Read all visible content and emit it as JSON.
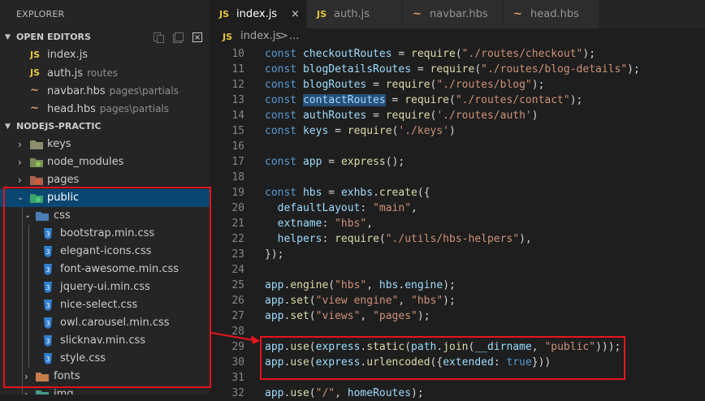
{
  "explorer": {
    "title": "EXPLORER",
    "open_editors": {
      "label": "OPEN EDITORS",
      "items": [
        {
          "icon": "JS",
          "name": "index.js",
          "path": ""
        },
        {
          "icon": "JS",
          "name": "auth.js",
          "path": "routes"
        },
        {
          "icon": "~",
          "name": "navbar.hbs",
          "path": "pages\\partials"
        },
        {
          "icon": "~",
          "name": "head.hbs",
          "path": "pages\\partials"
        }
      ]
    },
    "project": {
      "label": "NODEJS-PRACTIC",
      "items": [
        {
          "name": "keys"
        },
        {
          "name": "node_modules"
        },
        {
          "name": "pages"
        },
        {
          "name": "public"
        },
        {
          "name": "css"
        },
        {
          "name": "bootstrap.min.css"
        },
        {
          "name": "elegant-icons.css"
        },
        {
          "name": "font-awesome.min.css"
        },
        {
          "name": "jquery-ui.min.css"
        },
        {
          "name": "nice-select.css"
        },
        {
          "name": "owl.carousel.min.css"
        },
        {
          "name": "slicknav.min.css"
        },
        {
          "name": "style.css"
        },
        {
          "name": "fonts"
        },
        {
          "name": "img"
        }
      ]
    }
  },
  "tabs": [
    {
      "icon": "JS",
      "label": "index.js",
      "close": "×"
    },
    {
      "icon": "JS",
      "label": "auth.js"
    },
    {
      "icon": "~",
      "label": "navbar.hbs"
    },
    {
      "icon": "~",
      "label": "head.hbs"
    }
  ],
  "breadcrumb": {
    "icon": "JS",
    "file": "index.js",
    "sep": ">",
    "more": "..."
  },
  "code_lines": [
    {
      "n": "10",
      "t": [
        [
          "k",
          "const "
        ],
        [
          "v",
          "checkoutRoutes"
        ],
        [
          "p",
          " = "
        ],
        [
          "f",
          "require"
        ],
        [
          "p",
          "("
        ],
        [
          "s",
          "\"./routes/checkout\""
        ],
        [
          "p",
          ");"
        ]
      ]
    },
    {
      "n": "11",
      "t": [
        [
          "k",
          "const "
        ],
        [
          "v",
          "blogDetailsRoutes"
        ],
        [
          "p",
          " = "
        ],
        [
          "f",
          "require"
        ],
        [
          "p",
          "("
        ],
        [
          "s",
          "\"./routes/blog-details\""
        ],
        [
          "p",
          ");"
        ]
      ]
    },
    {
      "n": "12",
      "t": [
        [
          "k",
          "const "
        ],
        [
          "v",
          "blogRoutes"
        ],
        [
          "p",
          " = "
        ],
        [
          "f",
          "require"
        ],
        [
          "p",
          "("
        ],
        [
          "s",
          "\"./routes/blog\""
        ],
        [
          "p",
          ");"
        ]
      ]
    },
    {
      "n": "13",
      "t": [
        [
          "k",
          "const "
        ],
        [
          "hl",
          "contactRoutes"
        ],
        [
          "p",
          " = "
        ],
        [
          "f",
          "require"
        ],
        [
          "p",
          "("
        ],
        [
          "s",
          "\"./routes/contact\""
        ],
        [
          "p",
          ");"
        ]
      ]
    },
    {
      "n": "14",
      "t": [
        [
          "k",
          "const "
        ],
        [
          "v",
          "authRoutes"
        ],
        [
          "p",
          " = "
        ],
        [
          "f",
          "require"
        ],
        [
          "p",
          "("
        ],
        [
          "s",
          "'./routes/auth'"
        ],
        [
          "p",
          ")"
        ]
      ]
    },
    {
      "n": "15",
      "t": [
        [
          "k",
          "const "
        ],
        [
          "v",
          "keys"
        ],
        [
          "p",
          " = "
        ],
        [
          "f",
          "require"
        ],
        [
          "p",
          "("
        ],
        [
          "s",
          "'./keys'"
        ],
        [
          "p",
          ")"
        ]
      ]
    },
    {
      "n": "16",
      "t": []
    },
    {
      "n": "17",
      "t": [
        [
          "k",
          "const "
        ],
        [
          "v",
          "app"
        ],
        [
          "p",
          " = "
        ],
        [
          "f",
          "express"
        ],
        [
          "p",
          "();"
        ]
      ]
    },
    {
      "n": "18",
      "t": []
    },
    {
      "n": "19",
      "t": [
        [
          "k",
          "const "
        ],
        [
          "v",
          "hbs"
        ],
        [
          "p",
          " = "
        ],
        [
          "v",
          "exhbs"
        ],
        [
          "p",
          "."
        ],
        [
          "f",
          "create"
        ],
        [
          "p",
          "({"
        ]
      ]
    },
    {
      "n": "20",
      "t": [
        [
          "p",
          "  "
        ],
        [
          "v",
          "defaultLayout"
        ],
        [
          "p",
          ": "
        ],
        [
          "s",
          "\"main\""
        ],
        [
          "p",
          ","
        ]
      ]
    },
    {
      "n": "21",
      "t": [
        [
          "p",
          "  "
        ],
        [
          "v",
          "extname"
        ],
        [
          "p",
          ": "
        ],
        [
          "s",
          "\"hbs\""
        ],
        [
          "p",
          ","
        ]
      ]
    },
    {
      "n": "22",
      "t": [
        [
          "p",
          "  "
        ],
        [
          "v",
          "helpers"
        ],
        [
          "p",
          ": "
        ],
        [
          "f",
          "require"
        ],
        [
          "p",
          "("
        ],
        [
          "s",
          "\"./utils/hbs-helpers\""
        ],
        [
          "p",
          "),"
        ]
      ]
    },
    {
      "n": "23",
      "t": [
        [
          "p",
          "});"
        ]
      ]
    },
    {
      "n": "24",
      "t": []
    },
    {
      "n": "25",
      "t": [
        [
          "v",
          "app"
        ],
        [
          "p",
          "."
        ],
        [
          "f",
          "engine"
        ],
        [
          "p",
          "("
        ],
        [
          "s",
          "\"hbs\""
        ],
        [
          "p",
          ", "
        ],
        [
          "v",
          "hbs"
        ],
        [
          "p",
          "."
        ],
        [
          "v",
          "engine"
        ],
        [
          "p",
          ");"
        ]
      ]
    },
    {
      "n": "26",
      "t": [
        [
          "v",
          "app"
        ],
        [
          "p",
          "."
        ],
        [
          "f",
          "set"
        ],
        [
          "p",
          "("
        ],
        [
          "s",
          "\"view engine\""
        ],
        [
          "p",
          ", "
        ],
        [
          "s",
          "\"hbs\""
        ],
        [
          "p",
          ");"
        ]
      ]
    },
    {
      "n": "27",
      "t": [
        [
          "v",
          "app"
        ],
        [
          "p",
          "."
        ],
        [
          "f",
          "set"
        ],
        [
          "p",
          "("
        ],
        [
          "s",
          "\"views\""
        ],
        [
          "p",
          ", "
        ],
        [
          "s",
          "\"pages\""
        ],
        [
          "p",
          ");"
        ]
      ]
    },
    {
      "n": "28",
      "t": []
    },
    {
      "n": "29",
      "t": [
        [
          "v",
          "app"
        ],
        [
          "p",
          "."
        ],
        [
          "f",
          "use"
        ],
        [
          "p",
          "("
        ],
        [
          "v",
          "express"
        ],
        [
          "p",
          "."
        ],
        [
          "f",
          "static"
        ],
        [
          "p",
          "("
        ],
        [
          "v",
          "path"
        ],
        [
          "p",
          "."
        ],
        [
          "f",
          "join"
        ],
        [
          "p",
          "("
        ],
        [
          "v",
          "__dirname"
        ],
        [
          "p",
          ", "
        ],
        [
          "s",
          "\"public\""
        ],
        [
          "p",
          ")));"
        ]
      ]
    },
    {
      "n": "30",
      "t": [
        [
          "v",
          "app"
        ],
        [
          "p",
          "."
        ],
        [
          "f",
          "use"
        ],
        [
          "p",
          "("
        ],
        [
          "v",
          "express"
        ],
        [
          "p",
          "."
        ],
        [
          "f",
          "urlencoded"
        ],
        [
          "p",
          "({"
        ],
        [
          "v",
          "extended"
        ],
        [
          "p",
          ": "
        ],
        [
          "k",
          "true"
        ],
        [
          "p",
          "}))"
        ]
      ]
    },
    {
      "n": "31",
      "t": []
    },
    {
      "n": "32",
      "t": [
        [
          "v",
          "app"
        ],
        [
          "p",
          "."
        ],
        [
          "f",
          "use"
        ],
        [
          "p",
          "("
        ],
        [
          "s",
          "\"/\""
        ],
        [
          "p",
          ", "
        ],
        [
          "v",
          "homeRoutes"
        ],
        [
          "p",
          ");"
        ]
      ]
    }
  ],
  "colors": {
    "highlight_box": "#e8141c",
    "selection": "#094771",
    "accent_js": "#e8c63b"
  }
}
